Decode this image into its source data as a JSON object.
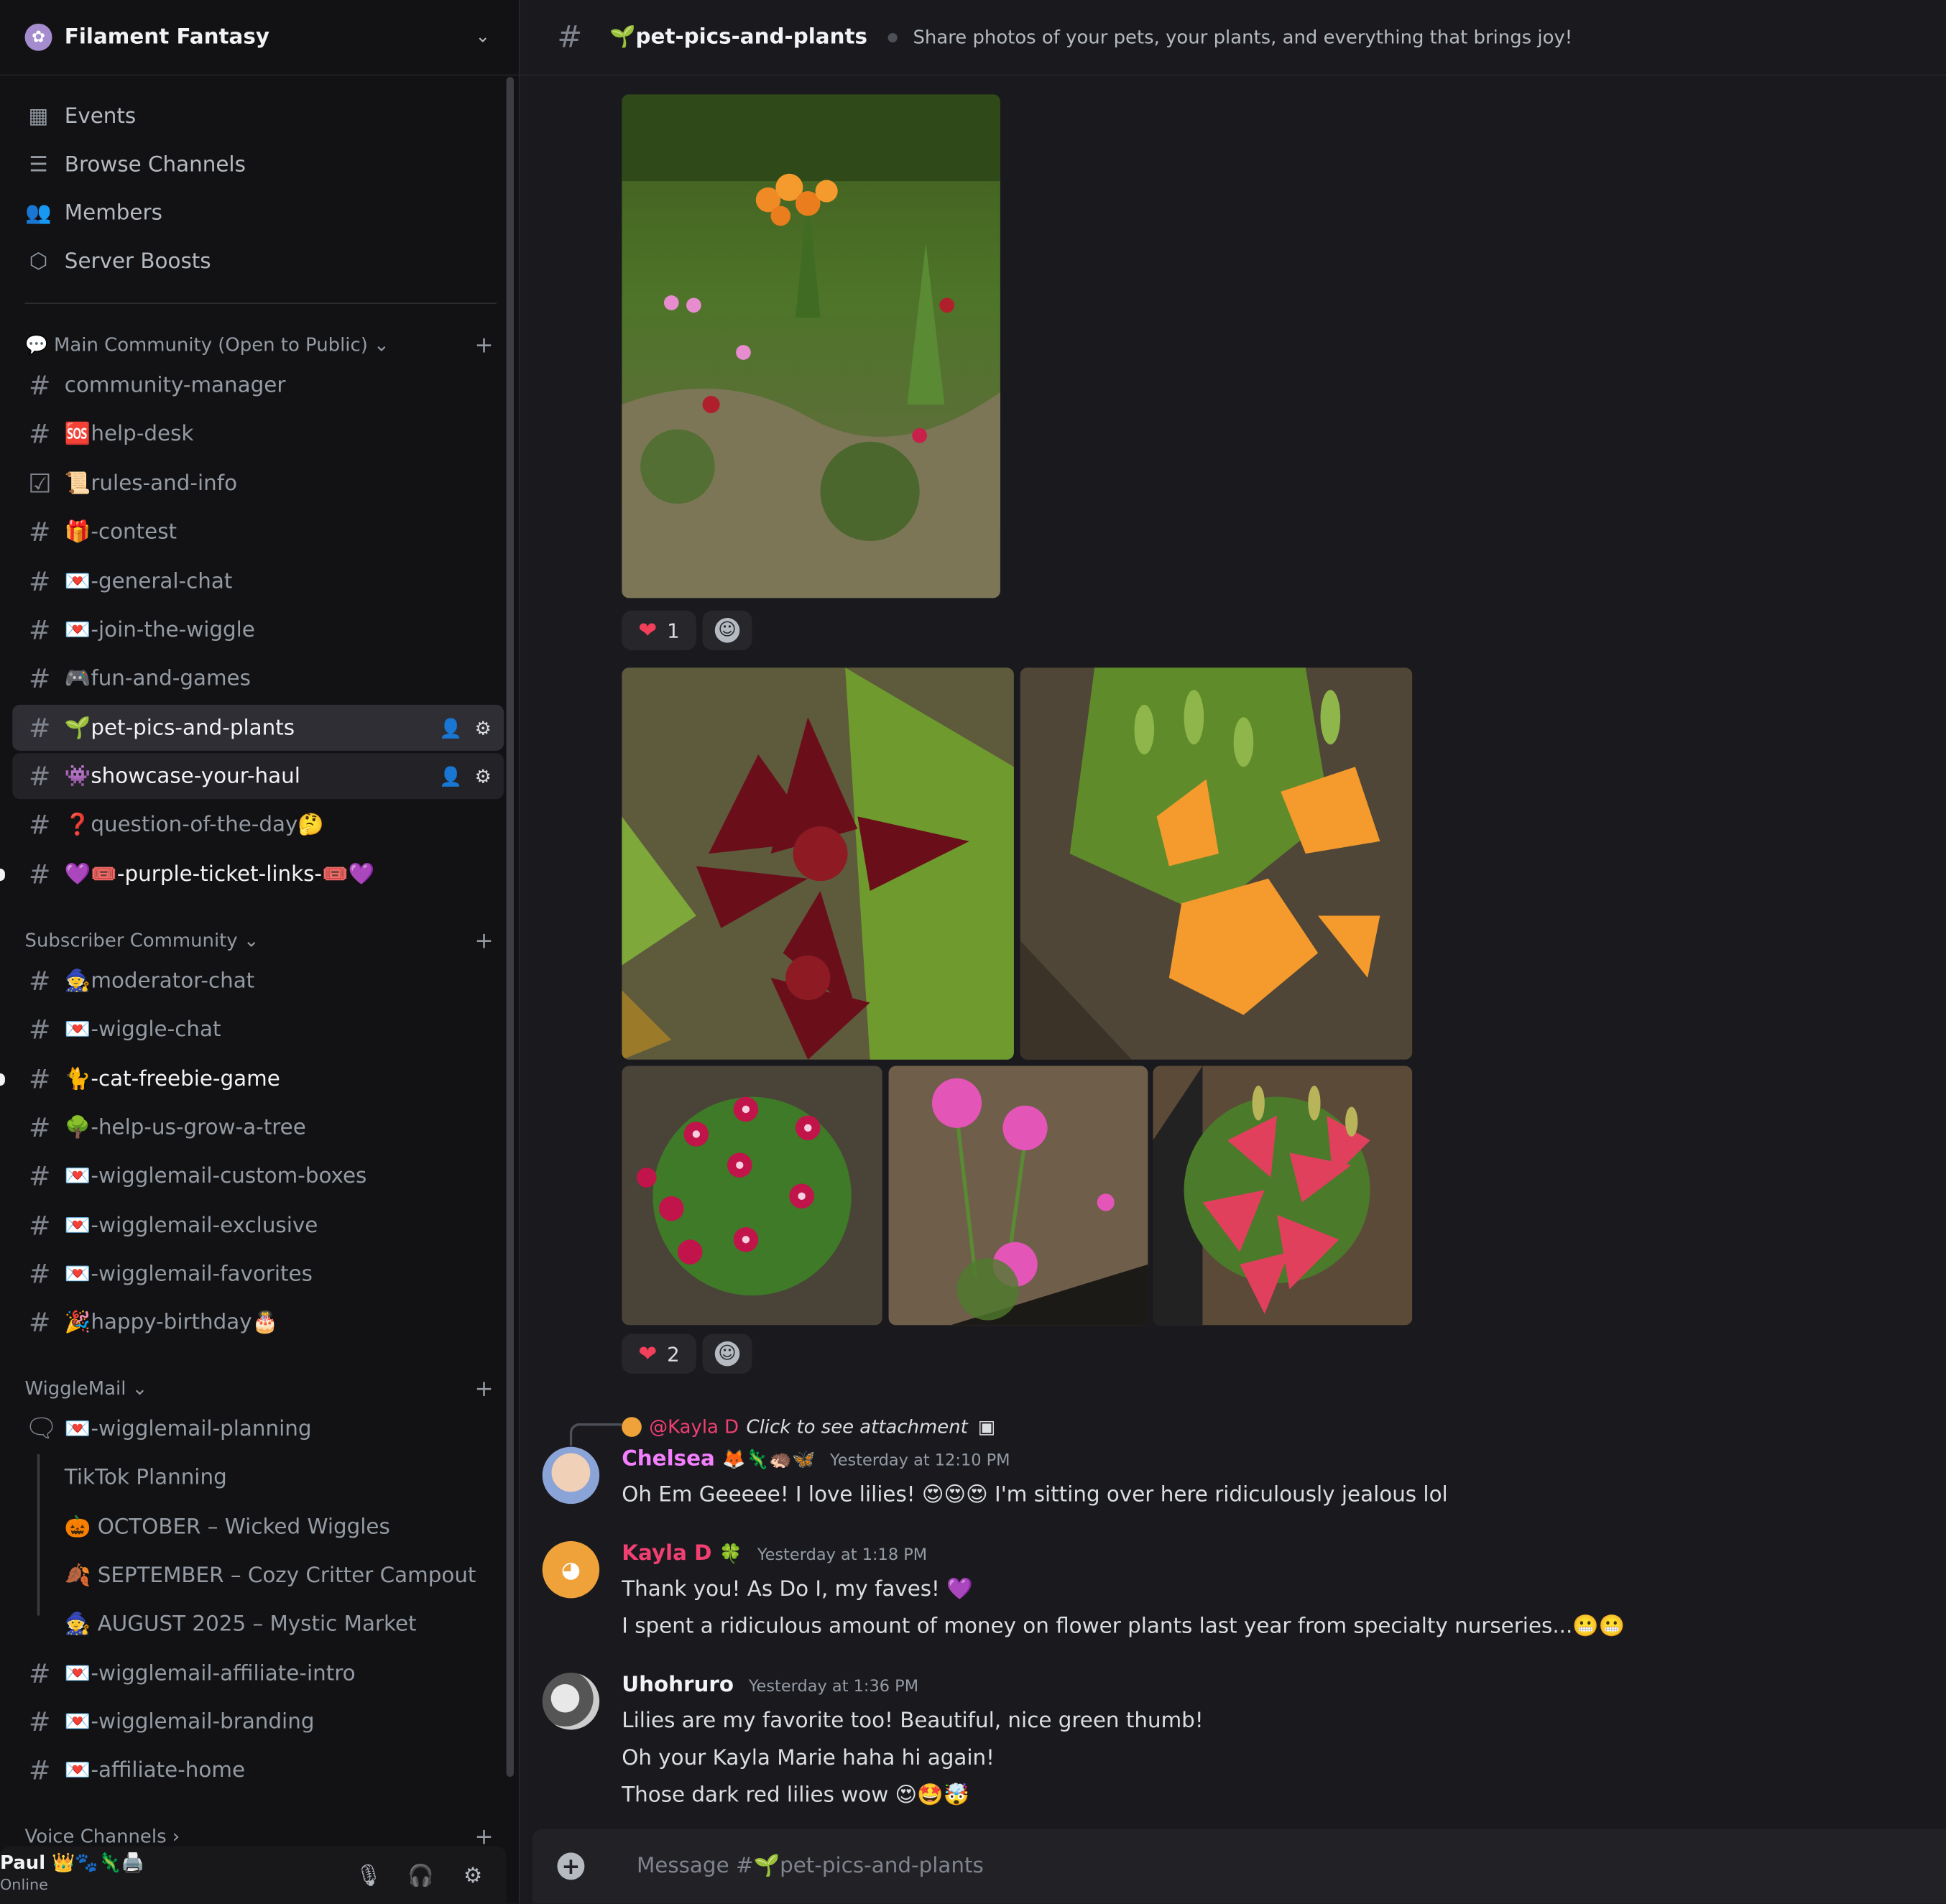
{
  "server": {
    "name": "Filament Fantasy",
    "icon": "✿"
  },
  "nav": [
    {
      "label": "Events",
      "icon": "▦"
    },
    {
      "label": "Browse Channels",
      "icon": "☰"
    },
    {
      "label": "Members",
      "icon": "👥"
    },
    {
      "label": "Server Boosts",
      "icon": "⬡"
    }
  ],
  "categories": {
    "main": "💬 Main Community (Open to Public) ⌄",
    "subscriber": "Subscriber Community ⌄",
    "wigglemail": "WiggleMail ⌄",
    "voice": "Voice Channels ›"
  },
  "channels_main": [
    {
      "name": "community-manager",
      "icon": "#"
    },
    {
      "name": "🆘help-desk",
      "icon": "#"
    },
    {
      "name": "📜rules-and-info",
      "icon": "☑"
    },
    {
      "name": "🎁-contest",
      "icon": "#"
    },
    {
      "name": "💌-general-chat",
      "icon": "#"
    },
    {
      "name": "💌-join-the-wiggle",
      "icon": "#"
    },
    {
      "name": "🎮fun-and-games",
      "icon": "#"
    },
    {
      "name": "🌱pet-pics-and-plants",
      "icon": "#"
    },
    {
      "name": "👾showcase-your-haul",
      "icon": "#"
    },
    {
      "name": "❓question-of-the-day🤔",
      "icon": "#"
    },
    {
      "name": "💜🎟️-purple-ticket-links-🎟️💜",
      "icon": "#"
    }
  ],
  "channels_subscriber": [
    {
      "name": "🧙moderator-chat",
      "icon": "#"
    },
    {
      "name": "💌-wiggle-chat",
      "icon": "#"
    },
    {
      "name": "🐈-cat-freebie-game",
      "icon": "#"
    },
    {
      "name": "🌳-help-us-grow-a-tree",
      "icon": "#"
    },
    {
      "name": "💌-wigglemail-custom-boxes",
      "icon": "#"
    },
    {
      "name": "💌-wigglemail-exclusive",
      "icon": "#"
    },
    {
      "name": "💌-wigglemail-favorites",
      "icon": "#"
    },
    {
      "name": "🎉happy-birthday🎂",
      "icon": "#"
    }
  ],
  "channels_wigglemail": {
    "forum": "💌-wigglemail-planning",
    "threads": [
      "TikTok Planning",
      "🎃 OCTOBER – Wicked Wiggles",
      "🍂 SEPTEMBER – Cozy Critter Campout",
      "🧙 AUGUST 2025 – Mystic Market"
    ],
    "rest": [
      "💌-wigglemail-affiliate-intro",
      "💌-wigglemail-branding",
      "💌-affiliate-home"
    ]
  },
  "user": {
    "name": "Paul 👑🐾🦎🖨️",
    "status": "Online"
  },
  "channel": {
    "title": "🌱pet-pics-and-plants",
    "topic": "Share photos of your pets, your plants, and everything that brings joy!"
  },
  "reactions": [
    {
      "emoji": "❤",
      "count": "1"
    },
    {
      "emoji": "❤",
      "count": "2"
    }
  ],
  "reply": {
    "mention": "@Kayla D",
    "text": "Click to see attachment"
  },
  "messages": [
    {
      "author": "Chelsea",
      "badges": "🦊🦎🦔🦋",
      "time": "Yesterday at 12:10 PM",
      "color": "#f47fff",
      "lines": [
        "Oh Em Geeeee! I love lilies! 😍😍😍 I'm sitting over here ridiculously jealous lol"
      ]
    },
    {
      "author": "Kayla D",
      "badges": "🍀",
      "time": "Yesterday at 1:18 PM",
      "color": "#f23f72",
      "lines": [
        "Thank you! As Do I, my faves! 💜",
        "I spent a ridiculous amount of money on flower plants last year from specialty nurseries...😬😬"
      ]
    },
    {
      "author": "Uhohruro",
      "badges": "",
      "time": "Yesterday at 1:36 PM",
      "color": "#f2f3f5",
      "lines": [
        "Lilies are my favorite too! Beautiful, nice green thumb!",
        "Oh your Kayla Marie haha hi again!",
        "Those dark red lilies wow 😍🤩🤯"
      ]
    }
  ],
  "composer": {
    "placeholder": "Message #🌱pet-pics-and-plants"
  }
}
